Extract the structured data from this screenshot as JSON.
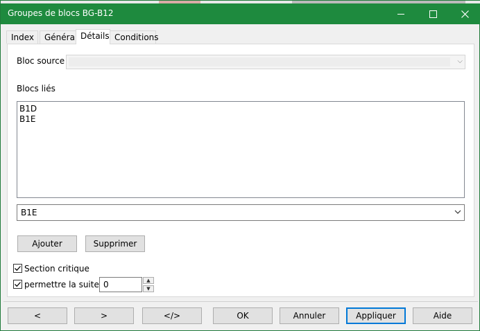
{
  "window": {
    "title": "Groupes de blocs BG-B12"
  },
  "tabs": [
    "Index",
    "Général",
    "Détails",
    "Conditions"
  ],
  "details": {
    "source_label": "Bloc source",
    "source_value": "",
    "linked_label": "Blocs liés",
    "linked_items": [
      "B1D",
      "B1E"
    ],
    "selected_block": "B1E",
    "add_label": "Ajouter",
    "remove_label": "Supprimer",
    "critical_label": "Section critique",
    "critical_checked": true,
    "allow_label": "permettre la suite",
    "allow_checked": true,
    "allow_value": "0"
  },
  "footer": {
    "prev": "<",
    "next": ">",
    "code": "</>",
    "ok": "OK",
    "cancel": "Annuler",
    "apply": "Appliquer",
    "help": "Aide"
  },
  "colors": {
    "titlebar": "#1e8a3e",
    "accent": "#0078d7"
  },
  "icons": [
    "minimize-icon",
    "maximize-icon",
    "close-icon",
    "chevron-down-icon",
    "checkmark-icon",
    "spin-up-icon",
    "spin-down-icon"
  ]
}
